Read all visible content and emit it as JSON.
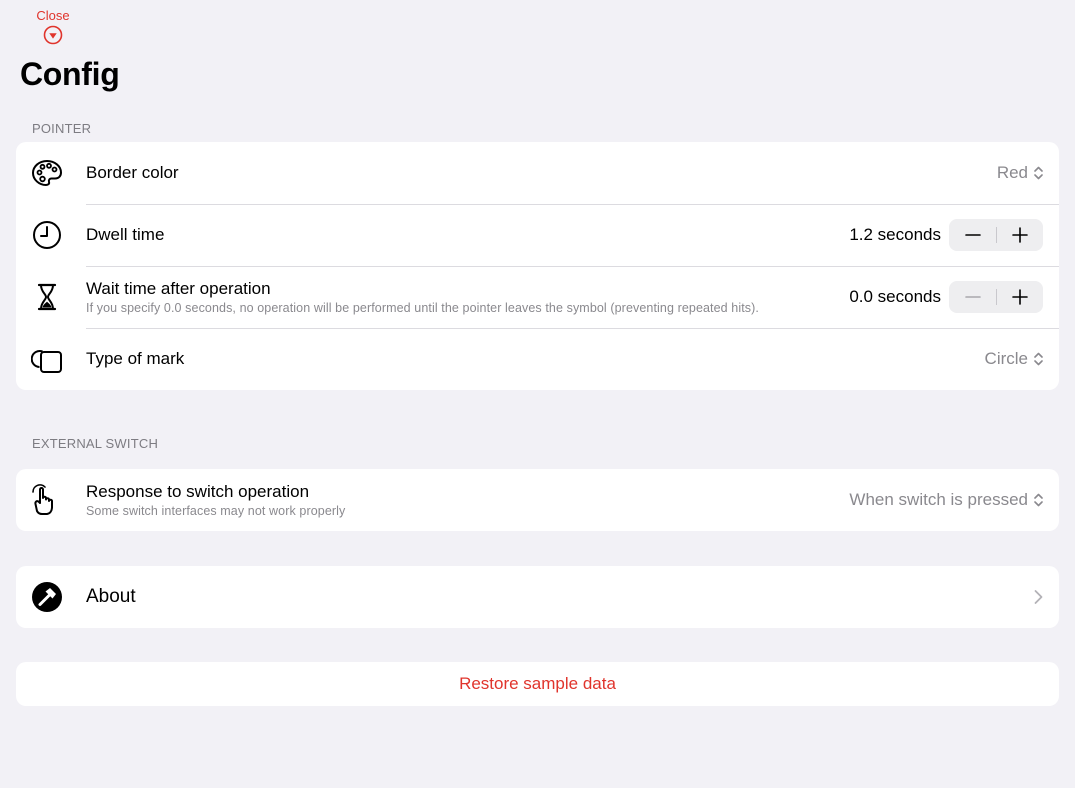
{
  "header": {
    "close_label": "Close",
    "title": "Config"
  },
  "colors": {
    "accent": "#e0342c",
    "background": "#f2f1f6",
    "secondary_text": "#8a898e"
  },
  "pointer_section": {
    "header": "POINTER",
    "border_color": {
      "label": "Border color",
      "value": "Red",
      "icon": "palette-icon"
    },
    "dwell_time": {
      "label": "Dwell time",
      "value": "1.2 seconds",
      "icon": "clock-icon"
    },
    "wait_time": {
      "label": "Wait time after operation",
      "description": "If you specify 0.0 seconds, no operation will be performed until the pointer leaves the symbol (preventing repeated hits).",
      "value": "0.0 seconds",
      "icon": "hourglass-icon"
    },
    "mark_type": {
      "label": "Type of mark",
      "value": "Circle",
      "icon": "square-on-circle-icon"
    }
  },
  "external_switch_section": {
    "header": "EXTERNAL SWITCH",
    "response": {
      "label": "Response to switch operation",
      "description": "Some switch interfaces may not work properly",
      "value": "When switch is pressed",
      "icon": "hand-point-icon"
    }
  },
  "about": {
    "label": "About",
    "icon": "hammer-circle-icon"
  },
  "restore": {
    "label": "Restore sample data"
  }
}
